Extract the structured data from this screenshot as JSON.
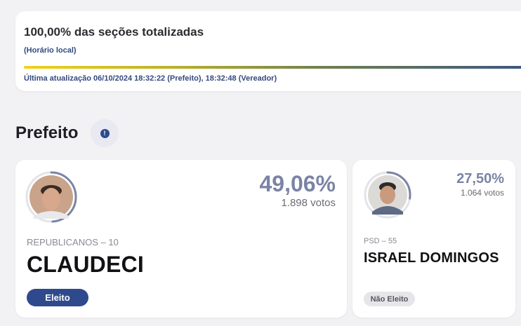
{
  "status": {
    "title": "100,00% das seções totalizadas",
    "subtitle": "(Horário local)",
    "progress_percent": 100,
    "last_update": "Última atualização 06/10/2024 18:32:22 (Prefeito), 18:32:48 (Vereador)"
  },
  "section": {
    "title": "Prefeito",
    "info_icon": "info-icon",
    "info_symbol": "!"
  },
  "candidates": [
    {
      "party": "REPUBLICANOS – 10",
      "name": "CLAUDECI",
      "percent": "49,06%",
      "votes": "1.898 votos",
      "vote_share": 0.4906,
      "status": "Eleito"
    },
    {
      "party": "PSD – 55",
      "name": "ISRAEL DOMINGOS",
      "percent": "27,50%",
      "votes": "1.064 votos",
      "vote_share": 0.275,
      "status": "Não Eleito"
    }
  ],
  "colors": {
    "accent": "#2f4a8c",
    "ring": "#7b84a6",
    "progress_start": "#f2d21a",
    "progress_end": "#3b5683"
  }
}
